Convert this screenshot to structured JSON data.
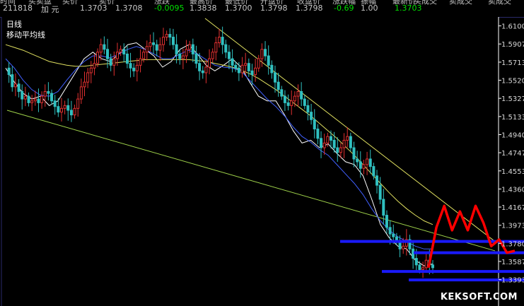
{
  "quote_bar": {
    "headers": [
      "时间",
      "买卖盘",
      "买价",
      "卖价",
      "涨跌",
      "最高价",
      "最低价",
      "开盘价",
      "收盘价",
      "涨跌幅",
      "振幅",
      "最新价",
      "买成交",
      "卖成交",
      "卖成交"
    ],
    "values": [
      {
        "text": "211818",
        "color": "#c8c8c8"
      },
      {
        "text": "加 元",
        "color": "#c8c8c8"
      },
      {
        "text": "1.3703",
        "color": "#c8c8c8"
      },
      {
        "text": "1.3708",
        "color": "#c8c8c8"
      },
      {
        "text": "-0.0095",
        "color": "#00e000"
      },
      {
        "text": "1.3838",
        "color": "#c8c8c8"
      },
      {
        "text": "1.3700",
        "color": "#c8c8c8"
      },
      {
        "text": "1.3798",
        "color": "#c8c8c8"
      },
      {
        "text": "1.3798",
        "color": "#c8c8c8"
      },
      {
        "text": "-0.69",
        "color": "#00e000"
      },
      {
        "text": "1.00",
        "color": "#c8c8c8"
      },
      {
        "text": "1.3703",
        "color": "#00e000"
      }
    ]
  },
  "chart_panel": {
    "period_label": "日线",
    "indicator_label": "移动平均线",
    "watermark": "KEKSOFT.COM"
  },
  "chart_data": {
    "type": "candlestick",
    "y_ticks": [
      "1.6100",
      "1.5907",
      "1.5713",
      "1.5520",
      "1.5327",
      "1.5133",
      "1.4940",
      "1.4747",
      "1.4553",
      "1.4360",
      "1.4167",
      "1.3973",
      "1.3780",
      "1.3587",
      "1.3393"
    ],
    "ylim": [
      1.33,
      1.615
    ],
    "close_path": [
      1.565,
      1.558,
      1.545,
      1.548,
      1.54,
      1.532,
      1.535,
      1.528,
      1.53,
      1.532,
      1.528,
      1.535,
      1.54,
      1.538,
      1.53,
      1.524,
      1.518,
      1.522,
      1.525,
      1.52,
      1.515,
      1.522,
      1.532,
      1.545,
      1.55,
      1.56,
      1.565,
      1.57,
      1.582,
      1.59,
      1.585,
      1.575,
      1.568,
      1.575,
      1.582,
      1.585,
      1.58,
      1.57,
      1.565,
      1.562,
      1.568,
      1.575,
      1.582,
      1.588,
      1.592,
      1.59,
      1.584,
      1.59,
      1.598,
      1.601,
      1.598,
      1.59,
      1.58,
      1.575,
      1.578,
      1.585,
      1.59,
      1.58,
      1.57,
      1.562,
      1.56,
      1.566,
      1.575,
      1.582,
      1.592,
      1.598,
      1.59,
      1.582,
      1.575,
      1.568,
      1.565,
      1.56,
      1.568,
      1.57,
      1.562,
      1.558,
      1.565,
      1.575,
      1.585,
      1.578,
      1.568,
      1.56,
      1.55,
      1.542,
      1.535,
      1.528,
      1.525,
      1.53,
      1.535,
      1.54,
      1.532,
      1.525,
      1.518,
      1.51,
      1.5,
      1.49,
      1.48,
      1.485,
      1.492,
      1.488,
      1.48,
      1.475,
      1.48,
      1.488,
      1.492,
      1.48,
      1.468,
      1.465,
      1.458,
      1.462,
      1.468,
      1.46,
      1.45,
      1.44,
      1.425,
      1.408,
      1.395,
      1.388,
      1.385,
      1.38,
      1.372,
      1.375,
      1.382,
      1.372,
      1.362,
      1.355,
      1.35,
      1.352,
      1.36,
      1.355,
      1.352
    ],
    "moving_averages": [
      {
        "color": "#ffffff",
        "points": [
          1.565,
          1.55,
          1.538,
          1.532,
          1.535,
          1.525,
          1.53,
          1.545,
          1.56,
          1.575,
          1.582,
          1.575,
          1.572,
          1.58,
          1.59,
          1.592,
          1.585,
          1.578,
          1.566,
          1.572,
          1.585,
          1.59,
          1.58,
          1.568,
          1.562,
          1.568,
          1.575,
          1.566,
          1.55,
          1.535,
          1.53,
          1.53,
          1.515,
          1.498,
          1.485,
          1.488,
          1.48,
          1.484,
          1.474,
          1.465,
          1.462,
          1.45,
          1.425,
          1.398,
          1.384,
          1.375,
          1.372,
          1.36,
          1.354,
          1.356
        ]
      },
      {
        "color": "#4060ff",
        "points": [
          1.575,
          1.565,
          1.552,
          1.542,
          1.536,
          1.535,
          1.54,
          1.552,
          1.563,
          1.572,
          1.578,
          1.578,
          1.576,
          1.58,
          1.585,
          1.588,
          1.585,
          1.58,
          1.575,
          1.575,
          1.58,
          1.584,
          1.58,
          1.574,
          1.568,
          1.566,
          1.565,
          1.562,
          1.552,
          1.542,
          1.532,
          1.524,
          1.514,
          1.502,
          1.492,
          1.486,
          1.478,
          1.472,
          1.462,
          1.452,
          1.442,
          1.43,
          1.415,
          1.402,
          1.392,
          1.385,
          1.38,
          1.375,
          1.372,
          1.372
        ]
      },
      {
        "color": "#e0e060",
        "points": [
          1.59,
          1.587,
          1.584,
          1.58,
          1.576,
          1.572,
          1.57,
          1.568,
          1.567,
          1.567,
          1.568,
          1.569,
          1.57,
          1.571,
          1.572,
          1.573,
          1.574,
          1.574,
          1.574,
          1.574,
          1.574,
          1.574,
          1.573,
          1.572,
          1.57,
          1.568,
          1.566,
          1.563,
          1.559,
          1.554,
          1.548,
          1.542,
          1.535,
          1.528,
          1.521,
          1.514,
          1.506,
          1.498,
          1.49,
          1.481,
          1.472,
          1.462,
          1.452,
          1.442,
          1.432,
          1.423,
          1.415,
          1.408,
          1.402,
          1.398
        ]
      }
    ],
    "support_lines": [
      1.38,
      1.368,
      1.348,
      1.339
    ],
    "trend_line_start": 1.52,
    "trend_line_end": 1.37,
    "upper_trend_start": 1.618,
    "upper_trend_end": 1.38,
    "forecast_path": [
      1.352,
      1.395,
      1.418,
      1.392,
      1.412,
      1.392,
      1.418,
      1.4,
      1.375,
      1.382,
      1.368,
      1.37
    ]
  }
}
